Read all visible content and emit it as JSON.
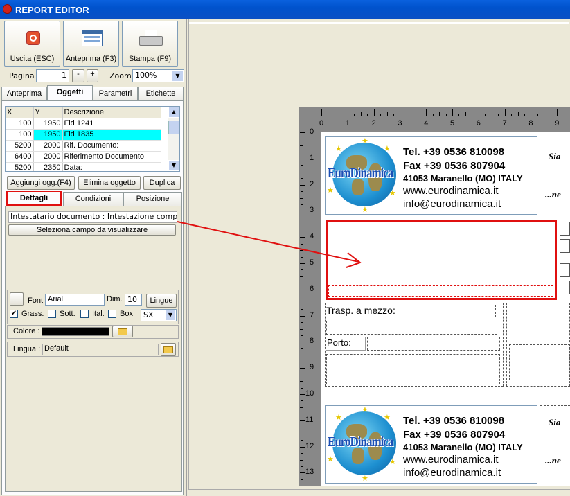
{
  "window": {
    "title": "REPORT EDITOR"
  },
  "toolbar": {
    "exit_label": "Uscita (ESC)",
    "preview_label": "Anteprima (F3)",
    "print_label": "Stampa (F9)"
  },
  "paging": {
    "page_label": "Pagina",
    "page_value": "1",
    "minus": "-",
    "plus": "+",
    "zoom_label": "Zoom",
    "zoom_value": "100%"
  },
  "tabs_top": [
    "Anteprima",
    "Oggetti",
    "Parametri",
    "Etichette"
  ],
  "objects_table": {
    "headers": [
      "X",
      "Y",
      "Descrizione"
    ],
    "rows": [
      [
        "100",
        "1950",
        "Fld 1241"
      ],
      [
        "100",
        "1950",
        "Fld 1835"
      ],
      [
        "5200",
        "2000",
        "Rif. Documento:"
      ],
      [
        "6400",
        "2000",
        "Riferimento Documento"
      ],
      [
        "5200",
        "2350",
        "Data:"
      ]
    ]
  },
  "object_buttons": {
    "add": "Aggiungi ogg.(F4)",
    "delete": "Elimina oggetto",
    "duplicate": "Duplica"
  },
  "tabs_detail": [
    "Dettagli",
    "Condizioni",
    "Posizione"
  ],
  "details": {
    "field_text": "Intestatario documento : Intestazione completa",
    "select_button": "Seleziona campo da visualizzare"
  },
  "font": {
    "font_label": "Font",
    "font_value": "Arial",
    "size_label": "Dim.",
    "size_value": "10",
    "lang_button": "Lingue",
    "bold_label": "Grass.",
    "underline_label": "Sott.",
    "italic_label": "Ital.",
    "box_label": "Box",
    "align_value": "SX",
    "color_label": "Colore :",
    "color_value": "#000000",
    "language_label": "Lingua :",
    "language_value": "Default"
  },
  "ruler": {
    "h": [
      "0",
      "1",
      "2",
      "3",
      "4",
      "5",
      "6",
      "7",
      "8",
      "9"
    ],
    "v": [
      "0",
      "1",
      "2",
      "3",
      "4",
      "5",
      "6",
      "7",
      "8",
      "9",
      "10",
      "11",
      "12",
      "13"
    ]
  },
  "card": {
    "brand": "EuroDinamica",
    "tel": "Tel. +39 0536 810098",
    "fax": "Fax +39 0536 807904",
    "address": "41053 Maranello (MO) ITALY",
    "web": "www.eurodinamica.it",
    "mail": "info@eurodinamica.it",
    "side1": "Sia",
    "side2": "...ne"
  },
  "form": {
    "transport_label": "Trasp. a mezzo:",
    "port_label": "Porto:"
  },
  "colors": {
    "selection": "#00FFFF",
    "highlight": "#E01010",
    "titlebar": "#0A61DE"
  }
}
